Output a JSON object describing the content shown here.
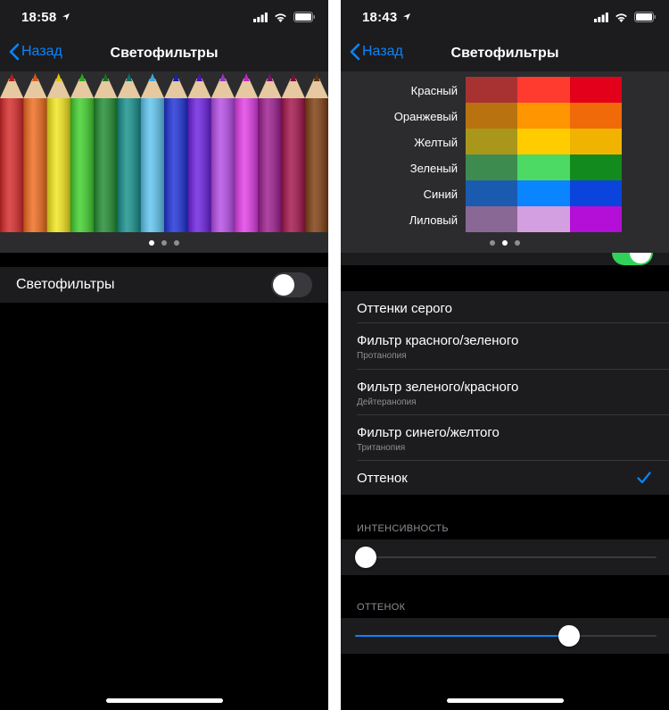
{
  "left": {
    "status": {
      "time": "18:58"
    },
    "nav": {
      "back_label": "Назад",
      "title": "Светофильтры"
    },
    "pencils": [
      {
        "color": "#d62828",
        "tip": "#b51e1e"
      },
      {
        "color": "#ef6a1c",
        "tip": "#d8571a"
      },
      {
        "color": "#f3e51b",
        "tip": "#d9c80f"
      },
      {
        "color": "#3fcf2a",
        "tip": "#28a818"
      },
      {
        "color": "#1e8b2f",
        "tip": "#146f22"
      },
      {
        "color": "#148f8a",
        "tip": "#0d6f6b"
      },
      {
        "color": "#5ec4ef",
        "tip": "#3aa8dc"
      },
      {
        "color": "#1c30d6",
        "tip": "#1322ad"
      },
      {
        "color": "#6a1ee0",
        "tip": "#5311ba"
      },
      {
        "color": "#b64be6",
        "tip": "#9632c6"
      },
      {
        "color": "#e13ce6",
        "tip": "#c423c8"
      },
      {
        "color": "#9c1b8e",
        "tip": "#7d1270"
      },
      {
        "color": "#a3134a",
        "tip": "#810b39"
      },
      {
        "color": "#7d3c0f",
        "tip": "#62300a"
      }
    ],
    "pager": {
      "count": 3,
      "active": 0
    },
    "toggle": {
      "label": "Светофильтры",
      "on": false
    }
  },
  "right": {
    "status": {
      "time": "18:43"
    },
    "nav": {
      "back_label": "Назад",
      "title": "Светофильтры"
    },
    "swatches": [
      {
        "label": "Красный",
        "colors": [
          "#a83232",
          "#ff3b30",
          "#e3001b"
        ]
      },
      {
        "label": "Оранжевый",
        "colors": [
          "#b87310",
          "#ff9500",
          "#f06a0a"
        ]
      },
      {
        "label": "Желтый",
        "colors": [
          "#a8971b",
          "#ffcc00",
          "#f0b400"
        ]
      },
      {
        "label": "Зеленый",
        "colors": [
          "#3e8b4f",
          "#4cd964",
          "#138a1e"
        ]
      },
      {
        "label": "Синий",
        "colors": [
          "#1a5bb0",
          "#0a84ff",
          "#0a44dd"
        ]
      },
      {
        "label": "Лиловый",
        "colors": [
          "#8a6896",
          "#d49fe0",
          "#b40fd6"
        ]
      }
    ],
    "pager": {
      "count": 3,
      "active": 1
    },
    "filters": [
      {
        "title": "Оттенки серого",
        "subtitle": "",
        "selected": false
      },
      {
        "title": "Фильтр красного/зеленого",
        "subtitle": "Протанопия",
        "selected": false
      },
      {
        "title": "Фильтр зеленого/красного",
        "subtitle": "Дейтеранопия",
        "selected": false
      },
      {
        "title": "Фильтр синего/желтого",
        "subtitle": "Тританопия",
        "selected": false
      },
      {
        "title": "Оттенок",
        "subtitle": "",
        "selected": true
      }
    ],
    "intensity": {
      "header": "ИНТЕНСИВНОСТЬ",
      "value": 0.0
    },
    "hue": {
      "header": "ОТТЕНОК",
      "value": 0.71
    }
  },
  "colors": {
    "accent": "#0a84ff",
    "toggle_on": "#30d158"
  }
}
